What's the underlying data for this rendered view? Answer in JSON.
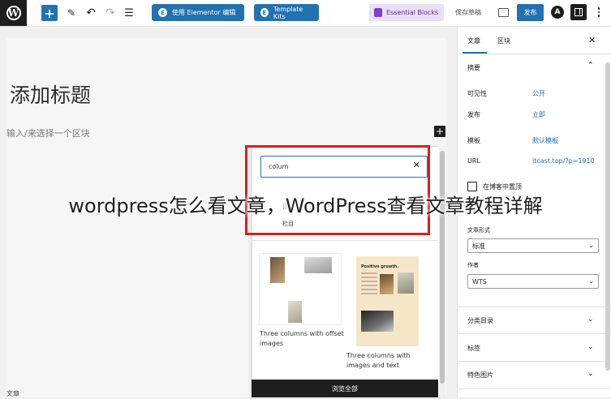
{
  "toolbar": {
    "elementor_label": "使用 Elementor 编辑",
    "template_kits_label": "Template Kits",
    "essential_blocks_label": "Essential Blocks",
    "save_draft_label": "保存草稿",
    "publish_label": "发布",
    "elementor_icon_text": "E",
    "wp_logo_text": "W"
  },
  "editor": {
    "title": "添加标题",
    "block_hint": "输入/来选择一个区块",
    "bottom_crumb": "文章"
  },
  "inserter": {
    "search_value": "colum",
    "result_label": "栏目",
    "result_icon_text": "|||",
    "patterns": [
      {
        "label": "Three columns with offset images"
      },
      {
        "label": "Three columns with images and text",
        "preview_title": "Positive growth."
      }
    ],
    "browse_all_label": "浏览全部"
  },
  "sidebar": {
    "tabs": [
      {
        "label": "文章"
      },
      {
        "label": "区块"
      }
    ],
    "summary_title": "摘要",
    "rows": [
      {
        "key": "可见性",
        "value": "公开"
      },
      {
        "key": "发布",
        "value": "立即"
      },
      {
        "key": "模板",
        "value": "默认模板"
      },
      {
        "key": "URL",
        "value": "itcast.top/?p=1910"
      }
    ],
    "checkbox_label": "在博客中置顶",
    "format_label": "文章形式",
    "format_value": "标准",
    "author_label": "作者",
    "author_value": "WTS",
    "sections": [
      {
        "label": "分类目录"
      },
      {
        "label": "标签"
      },
      {
        "label": "特色图片"
      }
    ]
  },
  "watermark": "wordpress怎么看文章，WordPress查看文章教程详解",
  "colors": {
    "accent": "#2271b1",
    "highlight_box": "#d81e1e",
    "dark": "#1e1e1e"
  }
}
